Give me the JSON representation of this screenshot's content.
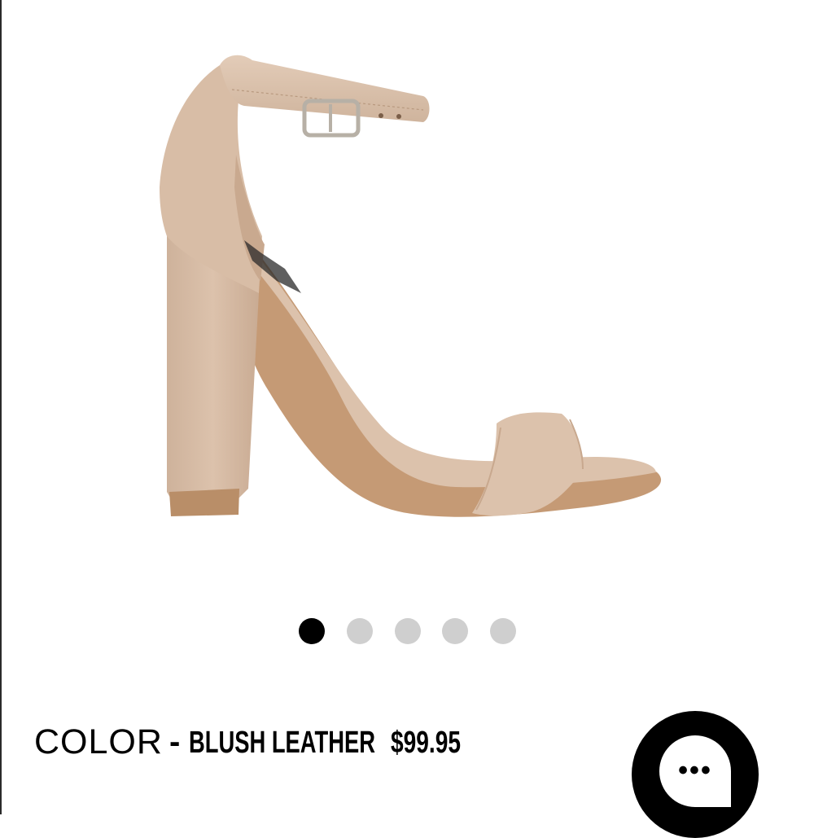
{
  "product": {
    "image_alt": "blush leather block heel sandal",
    "gallery": {
      "count": 5,
      "active_index": 0
    },
    "color_label": "COLOR",
    "color_separator": "-",
    "color_value": "BLUSH LEATHER",
    "price": "$99.95"
  },
  "chat": {
    "icon": "chat-bubble-icon",
    "dots": "•••"
  },
  "colors": {
    "leather": "#dcc2ac",
    "leather_shadow": "#c8a88e",
    "sole": "#c59a75",
    "dot_active": "#000000",
    "dot_inactive": "#cfcfcf"
  }
}
